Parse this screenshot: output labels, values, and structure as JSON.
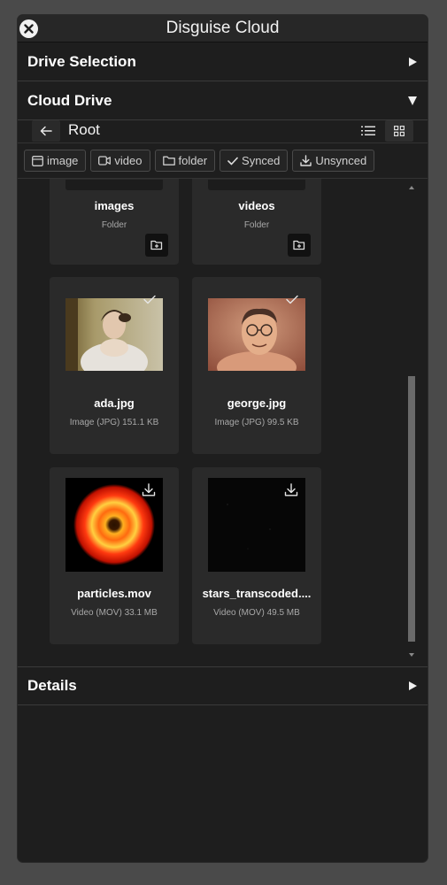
{
  "window": {
    "title": "Disguise Cloud",
    "close_icon": "close-circle-icon"
  },
  "sections": {
    "drive_selection": {
      "label": "Drive Selection",
      "state": "collapsed"
    },
    "cloud_drive": {
      "label": "Cloud Drive",
      "state": "expanded"
    },
    "details": {
      "label": "Details",
      "state": "collapsed"
    }
  },
  "path_bar": {
    "current": "Root",
    "back_icon": "arrow-left-icon",
    "view_modes": [
      "list",
      "grid"
    ],
    "active_view": "grid"
  },
  "filters": [
    {
      "label": "image",
      "icon": "image-icon"
    },
    {
      "label": "video",
      "icon": "video-icon"
    },
    {
      "label": "folder",
      "icon": "folder-icon"
    },
    {
      "label": "Synced",
      "icon": "check-icon"
    },
    {
      "label": "Unsynced",
      "icon": "download-icon"
    }
  ],
  "items": [
    {
      "name": "images",
      "meta": "Folder",
      "kind": "folder"
    },
    {
      "name": "videos",
      "meta": "Folder",
      "kind": "folder"
    },
    {
      "name": "ada.jpg",
      "meta": "Image (JPG)   151.1 KB",
      "kind": "image",
      "status": "synced"
    },
    {
      "name": "george.jpg",
      "meta": "Image (JPG)   99.5 KB",
      "kind": "image",
      "status": "synced"
    },
    {
      "name": "particles.mov",
      "meta": "Video (MOV)   33.1 MB",
      "kind": "video",
      "status": "unsynced"
    },
    {
      "name": "stars_transcoded....",
      "meta": "Video (MOV)   49.5 MB",
      "kind": "video",
      "status": "unsynced"
    }
  ],
  "colors": {
    "window_bg": "#1e1e1e",
    "card_bg": "#2a2a2a",
    "page_bg": "#4a4a4a",
    "text_primary": "#ffffff",
    "text_secondary": "#a8a8a8"
  }
}
